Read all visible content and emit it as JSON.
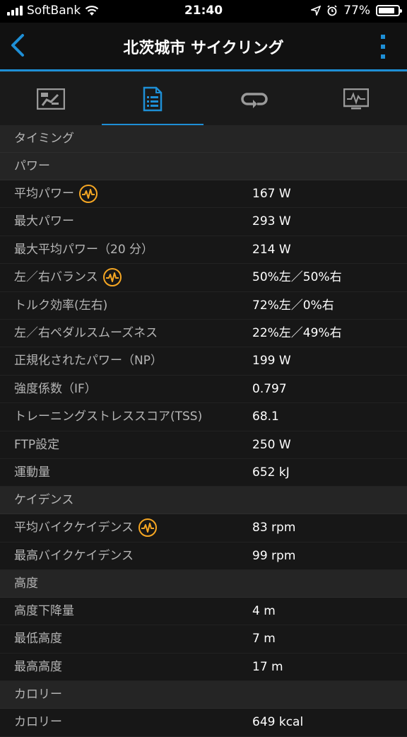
{
  "status_bar": {
    "carrier": "SoftBank",
    "time": "21:40",
    "battery": "77%"
  },
  "nav": {
    "title": "北茨城市 サイクリング"
  },
  "tabs": [
    {
      "icon": "summary-chart-icon",
      "active": false
    },
    {
      "icon": "details-list-icon",
      "active": true
    },
    {
      "icon": "laps-loop-icon",
      "active": false
    },
    {
      "icon": "graph-monitor-icon",
      "active": false
    }
  ],
  "sections": {
    "timing": "タイミング",
    "power": "パワー",
    "cadence": "ケイデンス",
    "elevation": "高度",
    "calories": "カロリー"
  },
  "power_rows": [
    {
      "label": "平均パワー",
      "value": "167 W"
    },
    {
      "label": "最大パワー",
      "value": "293 W"
    },
    {
      "label": "最大平均パワー（20 分）",
      "value": "214 W"
    },
    {
      "label": "左／右バランス",
      "value": "50%左／50%右"
    },
    {
      "label": "トルク効率(左右)",
      "value": "72%左／0%右"
    },
    {
      "label": "左／右ペダルスムーズネス",
      "value": "22%左／49%右"
    },
    {
      "label": "正規化されたパワー（NP）",
      "value": "199 W"
    },
    {
      "label": "強度係数（IF）",
      "value": "0.797"
    },
    {
      "label": "トレーニングストレススコア(TSS)",
      "value": "68.1"
    },
    {
      "label": "FTP設定",
      "value": "250 W"
    },
    {
      "label": "運動量",
      "value": "652 kJ"
    }
  ],
  "cadence_rows": [
    {
      "label": "平均バイクケイデンス",
      "value": "83 rpm"
    },
    {
      "label": "最高バイクケイデンス",
      "value": "99 rpm"
    }
  ],
  "elevation_rows": [
    {
      "label": "高度下降量",
      "value": "4 m"
    },
    {
      "label": "最低高度",
      "value": "7 m"
    },
    {
      "label": "最高高度",
      "value": "17 m"
    }
  ],
  "calorie_rows": [
    {
      "label": "カロリー",
      "value": "649 kcal"
    }
  ],
  "colors": {
    "accent": "#1e8fd6",
    "badge": "#f5a623"
  }
}
